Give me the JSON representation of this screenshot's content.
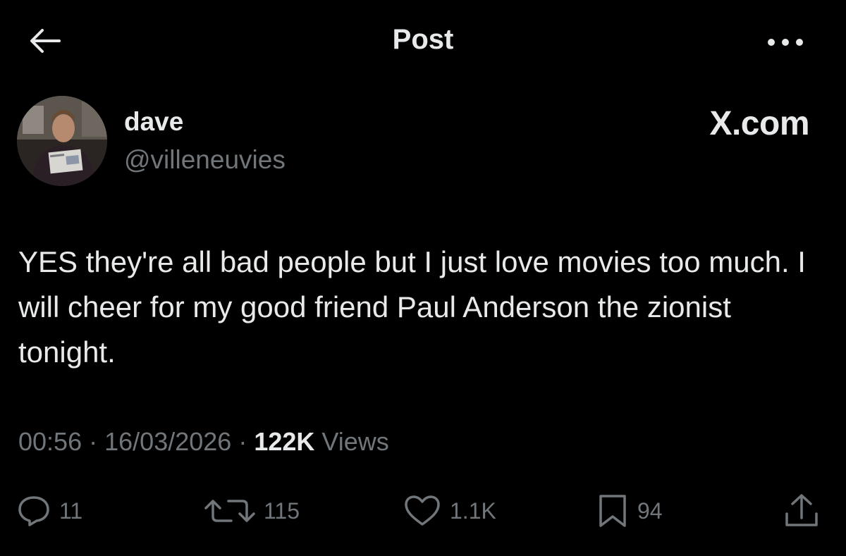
{
  "header": {
    "title": "Post",
    "back_icon": "arrow-left-icon",
    "more_icon": "more-horizontal-icon"
  },
  "author": {
    "display_name": "dave",
    "handle": "@villeneuvies",
    "avatar": "avatar-photo"
  },
  "brand": {
    "label": "X.com"
  },
  "post": {
    "text": "YES they're all bad people but I just love movies too much. I will cheer for my good friend Paul Anderson the zionist tonight.",
    "time": "00:56",
    "separator": "·",
    "date": "16/03/2026",
    "views_count": "122K",
    "views_label": "Views"
  },
  "actions": {
    "replies": "11",
    "reposts": "115",
    "likes": "1.1K",
    "bookmarks": "94",
    "reply_icon": "reply-icon",
    "repost_icon": "repost-icon",
    "like_icon": "heart-icon",
    "bookmark_icon": "bookmark-icon",
    "share_icon": "share-icon"
  },
  "colors": {
    "background": "#000000",
    "primary_text": "#e7e9ea",
    "secondary_text": "#71767b"
  }
}
